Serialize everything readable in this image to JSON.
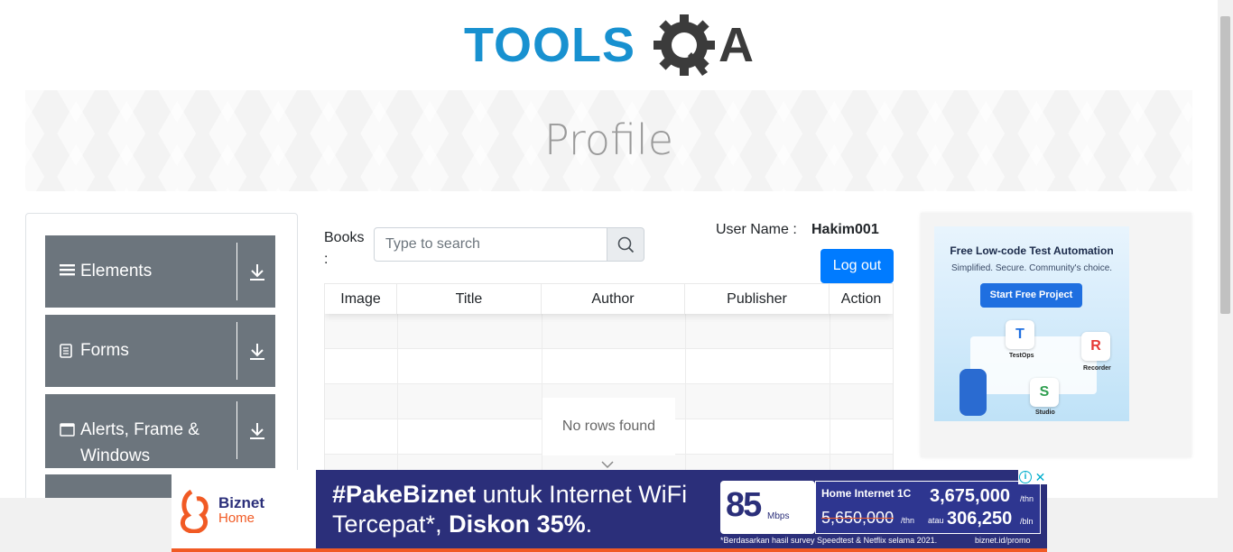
{
  "logo": {
    "text_left": "TOOLS",
    "text_right": "A",
    "colors": {
      "blue": "#1891d0",
      "dark": "#3b3b3b"
    }
  },
  "banner": {
    "title": "Profile"
  },
  "sidebar": {
    "groups": [
      {
        "label": "Elements",
        "icon": "hamburger-icon"
      },
      {
        "label": "Forms",
        "icon": "document-icon"
      },
      {
        "label": "Alerts, Frame & Windows",
        "icon": "window-icon"
      }
    ]
  },
  "books": {
    "label": "Books :",
    "search_placeholder": "Type to search"
  },
  "user": {
    "label": "User Name :",
    "value": "Hakim001",
    "logout": "Log out"
  },
  "table": {
    "columns": [
      "Image",
      "Title",
      "Author",
      "Publisher",
      "Action"
    ],
    "empty_message": "No rows found"
  },
  "ad_right": {
    "headline": "Free Low-code Test Automation",
    "subline": "Simplified. Secure. Community's choice.",
    "cta": "Start Free Project",
    "products": [
      "TestOps",
      "Recorder",
      "Studio"
    ]
  },
  "ad_bottom": {
    "brand_top": "Biznet",
    "brand_bottom": "Home",
    "line1_bold": "#PakeBiznet",
    "line1_rest": " untuk Internet WiFi",
    "line2_start": "Tercepat*, ",
    "line2_bold": "Diskon 35%",
    "line2_end": ".",
    "speed": "85",
    "speed_unit": "Mbps",
    "plan": "Home Internet 1C",
    "price_year": "3,675,000",
    "price_year_unit": "/thn",
    "old_price": "5,650,000",
    "old_price_unit": "/thn",
    "atau": "atau",
    "price_month": "306,250",
    "price_month_unit": "/bln",
    "footnote": "*Berdasarkan hasil survey Speedtest & Netflix selama 2021.",
    "url": "biznet.id/promo",
    "colors": {
      "navy": "#2b2f7a",
      "orange": "#f15a24"
    }
  },
  "accent": "#007bff"
}
